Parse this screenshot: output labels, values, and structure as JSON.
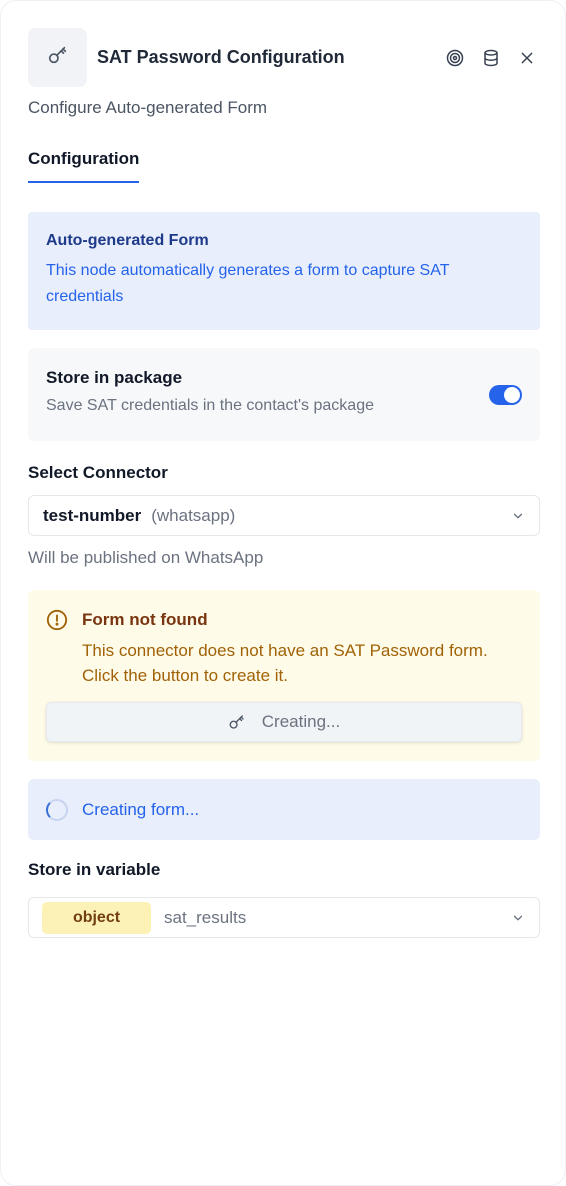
{
  "header": {
    "title": "SAT Password Configuration",
    "node_icon": "key-icon",
    "actions": [
      "target-icon",
      "database-icon",
      "close-icon"
    ]
  },
  "subtitle": "Configure Auto-generated Form",
  "tabs": [
    {
      "label": "Configuration",
      "active": true
    }
  ],
  "info": {
    "title": "Auto-generated Form",
    "text": "This node automatically generates a form to capture SAT credentials"
  },
  "store_package": {
    "label": "Store in package",
    "description": "Save SAT credentials in the contact's package",
    "enabled": true
  },
  "connector": {
    "label": "Select Connector",
    "value": "test-number",
    "channel": "(whatsapp)",
    "hint": "Will be published on WhatsApp"
  },
  "warning": {
    "title": "Form not found",
    "text": "This connector does not have an SAT Password form. Click the button to create it.",
    "button_label": "Creating..."
  },
  "progress": {
    "text": "Creating form..."
  },
  "variable": {
    "label": "Store in variable",
    "type": "object",
    "name": "sat_results"
  },
  "colors": {
    "accent": "#2563eb",
    "info_bg": "#e8eefb",
    "warning_bg": "#fefbe8",
    "chip_bg": "#fdf2b6"
  }
}
